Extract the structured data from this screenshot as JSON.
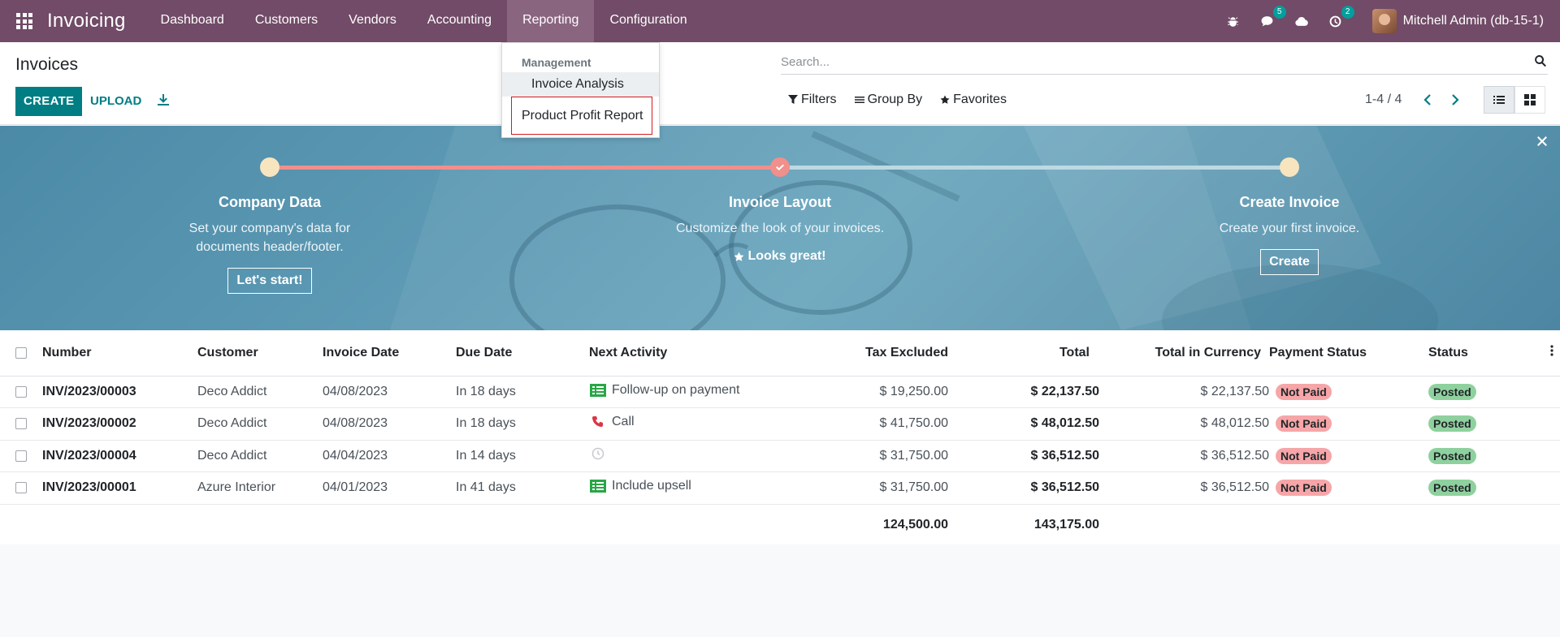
{
  "navbar": {
    "brand": "Invoicing",
    "menu": [
      "Dashboard",
      "Customers",
      "Vendors",
      "Accounting",
      "Reporting",
      "Configuration"
    ],
    "active_menu": "Reporting",
    "messages_count": "5",
    "activities_count": "2",
    "user_name": "Mitchell Admin (db-15-1)"
  },
  "control": {
    "title": "Invoices",
    "create_label": "CREATE",
    "upload_label": "UPLOAD",
    "search_placeholder": "Search...",
    "filters_label": "Filters",
    "groupby_label": "Group By",
    "favorites_label": "Favorites",
    "pager": "1-4 / 4"
  },
  "dropdown": {
    "header": "Management",
    "items": [
      "Invoice Analysis",
      "Product Profit Report"
    ]
  },
  "banner": {
    "steps": [
      {
        "title": "Company Data",
        "desc": "Set your company's data for documents header/footer.",
        "action": "Let's start!"
      },
      {
        "title": "Invoice Layout",
        "desc": "Customize the look of your invoices.",
        "action": "Looks great!"
      },
      {
        "title": "Create Invoice",
        "desc": "Create your first invoice.",
        "action": "Create"
      }
    ]
  },
  "table": {
    "columns": [
      "Number",
      "Customer",
      "Invoice Date",
      "Due Date",
      "Next Activity",
      "Tax Excluded",
      "Total",
      "Total in Currency",
      "Payment Status",
      "Status"
    ],
    "rows": [
      {
        "number": "INV/2023/00003",
        "customer": "Deco Addict",
        "invoice_date": "04/08/2023",
        "due_date": "In 18 days",
        "activity": "Follow-up on payment",
        "activity_icon": "todo-list-icon",
        "tax_excluded": "$ 19,250.00",
        "total": "$ 22,137.50",
        "total_currency": "$ 22,137.50",
        "payment_status": "Not Paid",
        "status": "Posted"
      },
      {
        "number": "INV/2023/00002",
        "customer": "Deco Addict",
        "invoice_date": "04/08/2023",
        "due_date": "In 18 days",
        "activity": "Call",
        "activity_icon": "phone-icon",
        "tax_excluded": "$ 41,750.00",
        "total": "$ 48,012.50",
        "total_currency": "$ 48,012.50",
        "payment_status": "Not Paid",
        "status": "Posted"
      },
      {
        "number": "INV/2023/00004",
        "customer": "Deco Addict",
        "invoice_date": "04/04/2023",
        "due_date": "In 14 days",
        "activity": "",
        "activity_icon": "clock-icon",
        "tax_excluded": "$ 31,750.00",
        "total": "$ 36,512.50",
        "total_currency": "$ 36,512.50",
        "payment_status": "Not Paid",
        "status": "Posted"
      },
      {
        "number": "INV/2023/00001",
        "customer": "Azure Interior",
        "invoice_date": "04/01/2023",
        "due_date": "In 41 days",
        "activity": "Include upsell",
        "activity_icon": "todo-list-icon",
        "tax_excluded": "$ 31,750.00",
        "total": "$ 36,512.50",
        "total_currency": "$ 36,512.50",
        "payment_status": "Not Paid",
        "status": "Posted"
      }
    ],
    "totals": {
      "tax_excluded": "124,500.00",
      "total": "143,175.00"
    }
  },
  "colors": {
    "brand": "#714b67",
    "primary": "#017e84",
    "not_paid": "#f6a6a8",
    "posted": "#8fd19e",
    "highlight_box": "#d8191f"
  }
}
